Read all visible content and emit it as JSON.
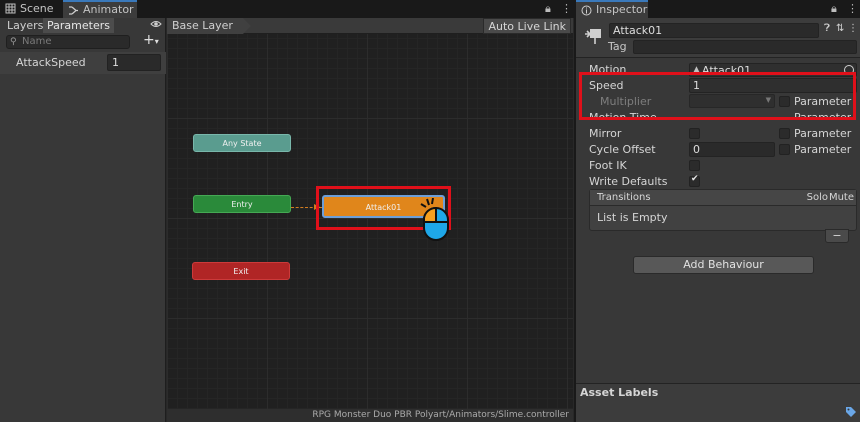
{
  "left_window": {
    "tabs": [
      {
        "label": "Scene",
        "icon": "grid-icon"
      },
      {
        "label": "Animator",
        "icon": "animator-icon"
      }
    ]
  },
  "parameters_panel": {
    "tabs": [
      "Layers",
      "Parameters"
    ],
    "search_placeholder": "Name",
    "add_symbol": "+",
    "params": [
      {
        "name": "AttackSpeed",
        "value": "1"
      }
    ]
  },
  "graph": {
    "breadcrumb": "Base Layer",
    "auto_live_link": "Auto Live Link",
    "states": {
      "any_state": "Any State",
      "entry": "Entry",
      "exit": "Exit",
      "attack": "Attack01"
    },
    "status_path": "RPG Monster Duo PBR Polyart/Animators/Slime.controller"
  },
  "inspector": {
    "tab_label": "Inspector",
    "state_name": "Attack01",
    "tag_label": "Tag",
    "tag_value": "",
    "motion_label": "Motion",
    "motion_value": "Attack01",
    "speed_label": "Speed",
    "speed_value": "1",
    "multiplier_label": "Multiplier",
    "parameter_label": "Parameter",
    "motion_time_label": "Motion Time",
    "mirror_label": "Mirror",
    "cycle_offset_label": "Cycle Offset",
    "cycle_offset_value": "0",
    "foot_ik_label": "Foot IK",
    "write_defaults_label": "Write Defaults",
    "write_defaults_checked": true,
    "transitions_label": "Transitions",
    "solo_label": "Solo",
    "mute_label": "Mute",
    "list_empty": "List is Empty",
    "remove_symbol": "−",
    "add_behaviour": "Add Behaviour",
    "asset_labels": "Asset Labels"
  },
  "colors": {
    "highlight": "#e0101a",
    "any_state": "#5a9c8f",
    "entry": "#2a8a3a",
    "exit": "#b02525",
    "attack": "#e0861b"
  }
}
